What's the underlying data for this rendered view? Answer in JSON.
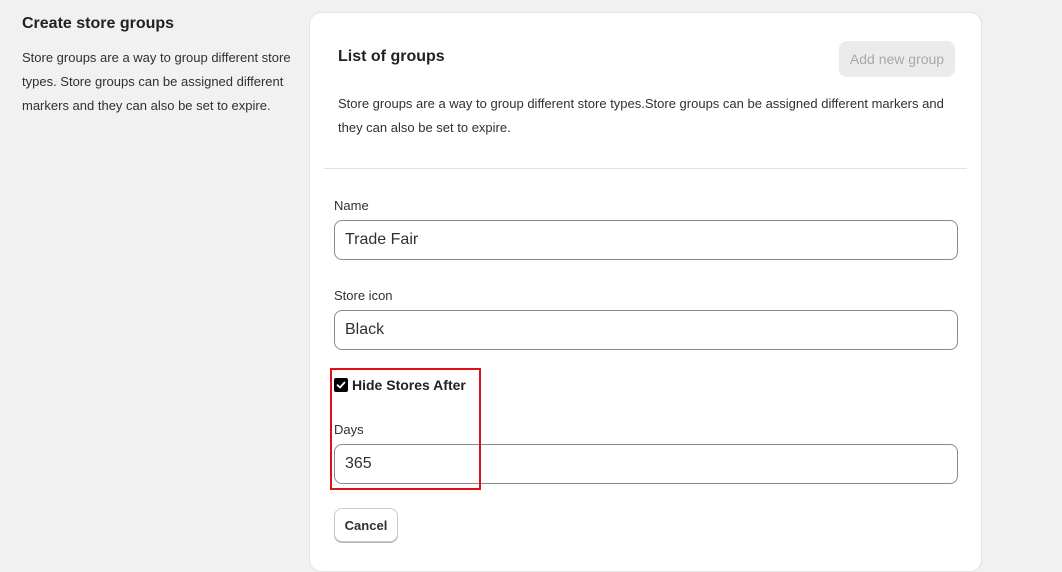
{
  "intro": {
    "title": "Create store groups",
    "description": "Store groups are a way to group different store types. Store groups can be assigned different markers and they can also be set to expire."
  },
  "card": {
    "title": "List of groups",
    "add_button_label": "Add new group",
    "description": "Store groups are a way to group different store types.Store groups can be assigned different markers and they can also be set to expire."
  },
  "form": {
    "name_label": "Name",
    "name_value": "Trade Fair",
    "icon_label": "Store icon",
    "icon_value": "Black",
    "hide_checkbox_label": "Hide Stores After",
    "hide_checked": true,
    "days_label": "Days",
    "days_value": "365",
    "cancel_label": "Cancel"
  },
  "colors": {
    "highlight": "#e0101a",
    "checkbox": "#000000",
    "background": "#f1f1f1"
  }
}
